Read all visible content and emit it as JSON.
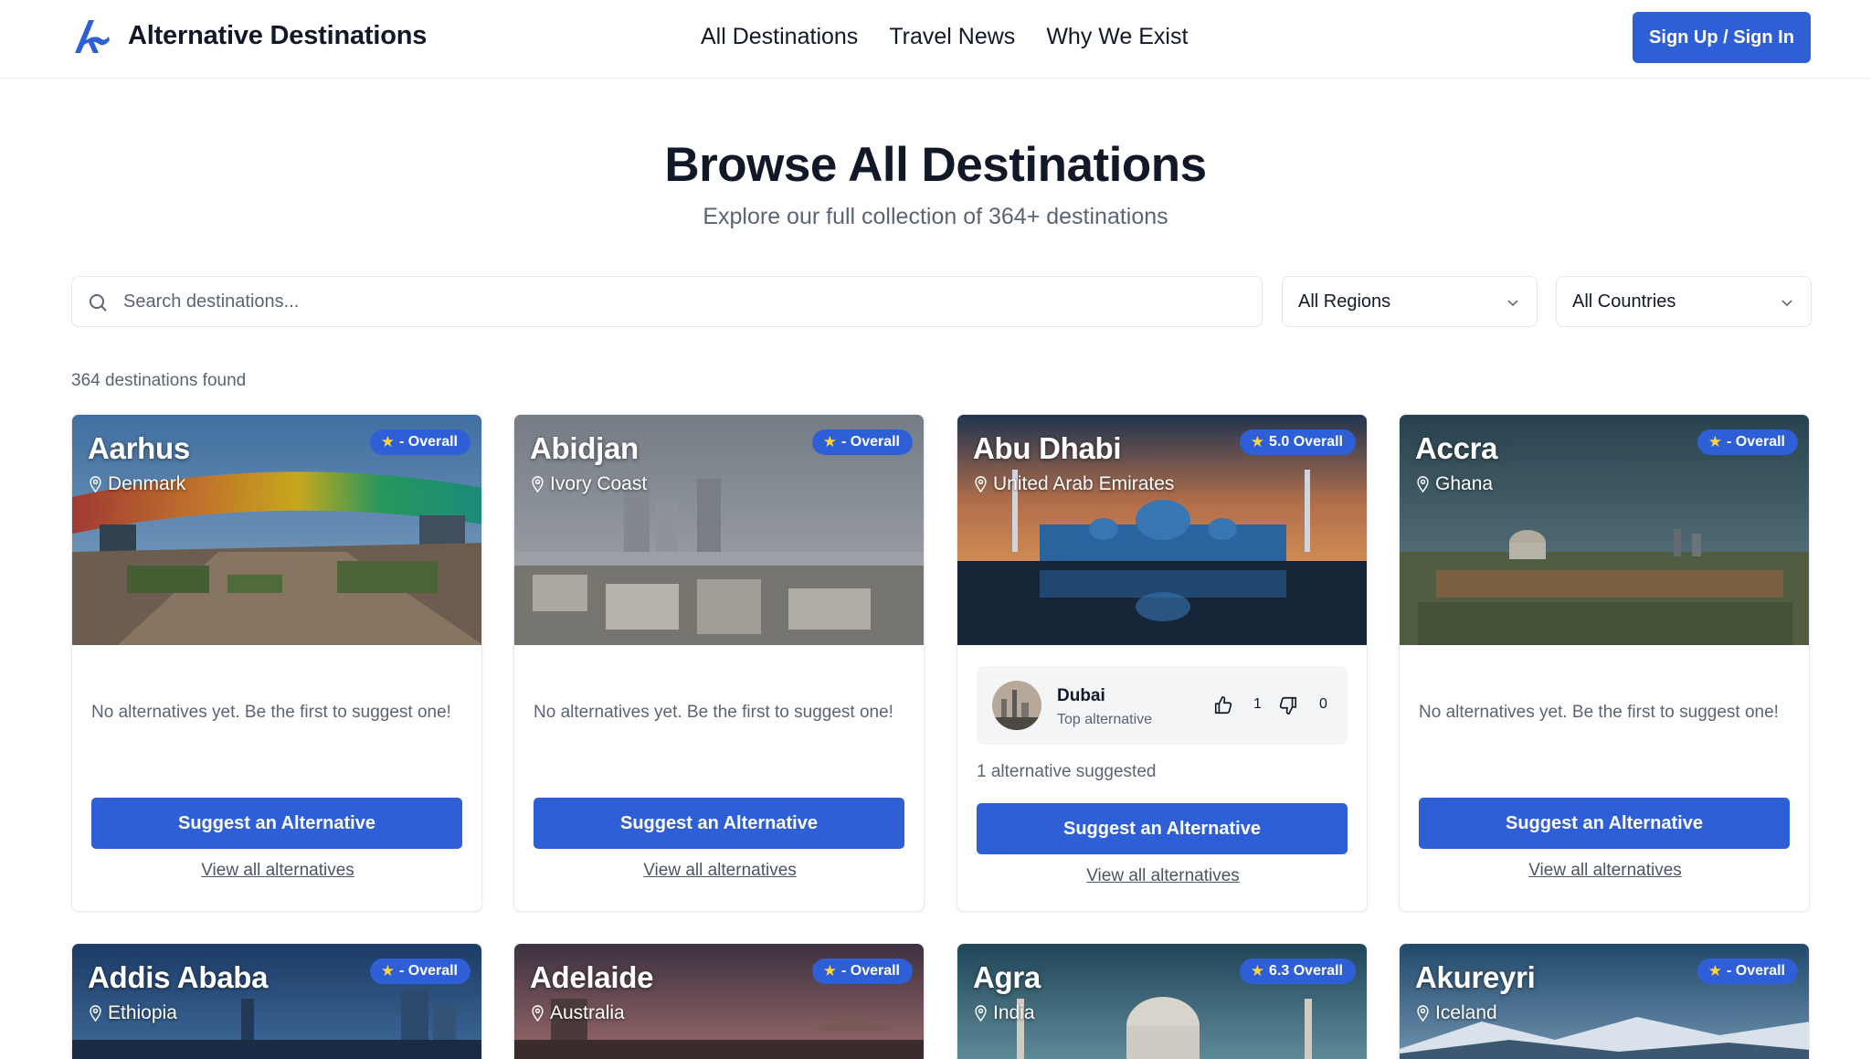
{
  "header": {
    "brand": "Alternative Destinations",
    "nav": [
      "All Destinations",
      "Travel News",
      "Why We Exist"
    ],
    "signup_label": "Sign Up / Sign In",
    "accent": "#2f5fd6"
  },
  "hero": {
    "title": "Browse All Destinations",
    "subtitle": "Explore our full collection of 364+ destinations"
  },
  "filters": {
    "search_placeholder": "Search destinations...",
    "region_value": "All Regions",
    "country_value": "All Countries"
  },
  "results": {
    "count_text": "364 destinations found"
  },
  "cards": [
    {
      "city": "Aarhus",
      "country": "Denmark",
      "rating": "- Overall",
      "empty_text": "No alternatives yet. Be the first to suggest one!",
      "suggest_label": "Suggest an Alternative",
      "view_label": "View all alternatives"
    },
    {
      "city": "Abidjan",
      "country": "Ivory Coast",
      "rating": "- Overall",
      "empty_text": "No alternatives yet. Be the first to suggest one!",
      "suggest_label": "Suggest an Alternative",
      "view_label": "View all alternatives"
    },
    {
      "city": "Abu Dhabi",
      "country": "United Arab Emirates",
      "rating": "5.0 Overall",
      "alt_name": "Dubai",
      "alt_sub": "Top alternative",
      "upvotes": "1",
      "downvotes": "0",
      "alt_count_text": "1 alternative suggested",
      "suggest_label": "Suggest an Alternative",
      "view_label": "View all alternatives"
    },
    {
      "city": "Accra",
      "country": "Ghana",
      "rating": "- Overall",
      "empty_text": "No alternatives yet. Be the first to suggest one!",
      "suggest_label": "Suggest an Alternative",
      "view_label": "View all alternatives"
    },
    {
      "city": "Addis Ababa",
      "country": "Ethiopia",
      "rating": "- Overall"
    },
    {
      "city": "Adelaide",
      "country": "Australia",
      "rating": "- Overall"
    },
    {
      "city": "Agra",
      "country": "India",
      "rating": "6.3 Overall"
    },
    {
      "city": "Akureyri",
      "country": "Iceland",
      "rating": "- Overall"
    }
  ]
}
